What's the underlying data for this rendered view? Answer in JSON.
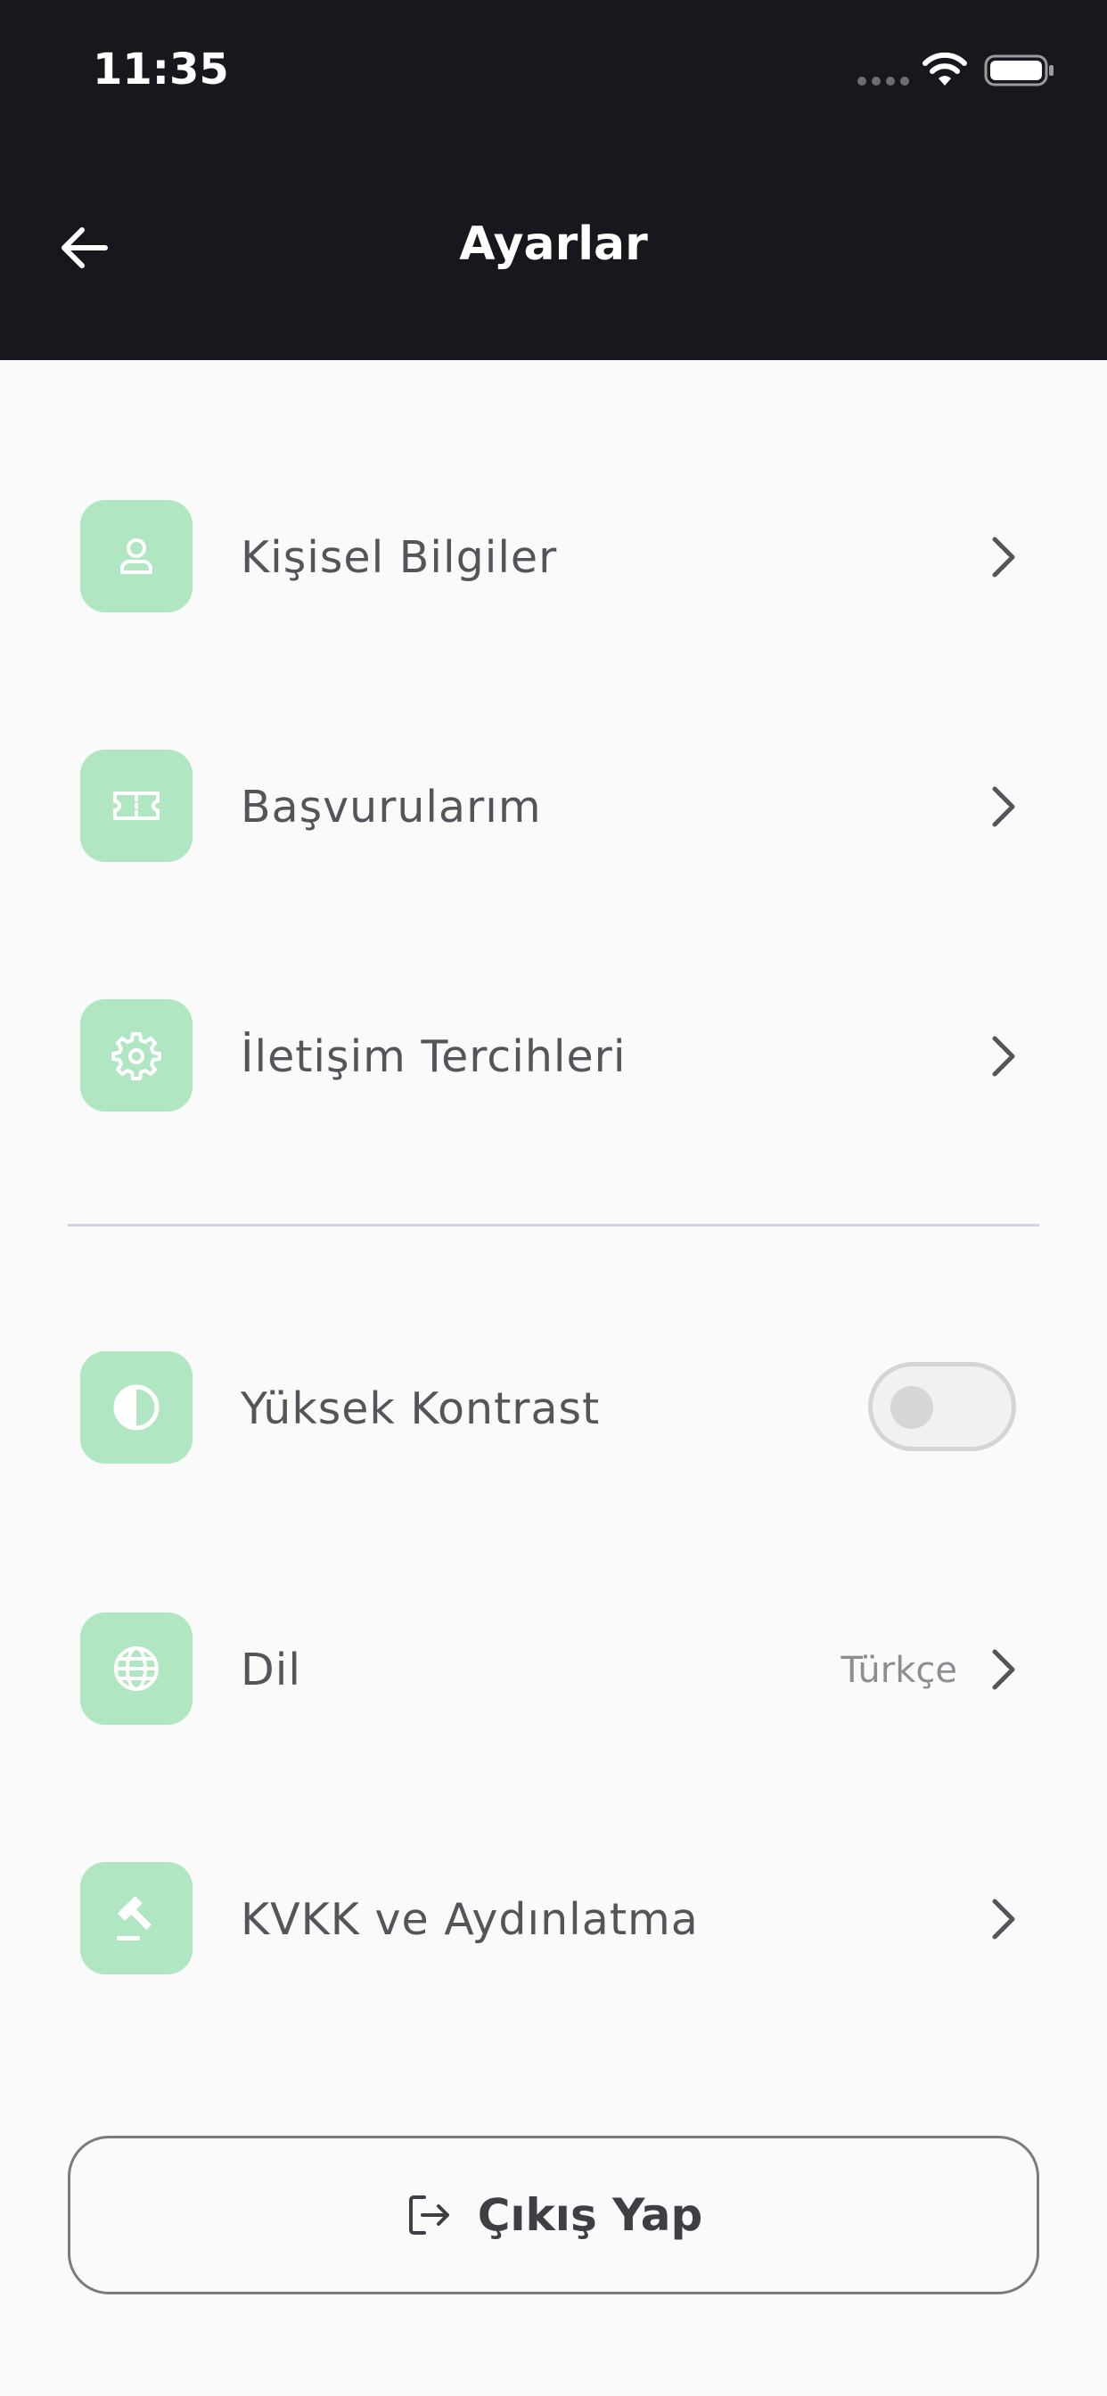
{
  "status_bar": {
    "time": "11:35"
  },
  "header": {
    "title": "Ayarlar"
  },
  "menu": [
    {
      "label": "Kişisel Bilgiler",
      "icon": "person-icon"
    },
    {
      "label": "Başvurularım",
      "icon": "ticket-icon"
    },
    {
      "label": "İletişim Tercihleri",
      "icon": "gear-icon"
    }
  ],
  "settings": {
    "high_contrast": {
      "label": "Yüksek Kontrast",
      "icon": "contrast-icon",
      "enabled": false
    },
    "language": {
      "label": "Dil",
      "value": "Türkçe",
      "icon": "globe-icon"
    },
    "kvkk": {
      "label": "KVKK ve Aydınlatma",
      "icon": "gavel-icon"
    }
  },
  "logout": {
    "label": "Çıkış Yap",
    "icon": "logout-icon"
  },
  "colors": {
    "header_bg": "#18171d",
    "icon_bg": "#b0e6c1",
    "page_bg": "#fafafa",
    "text": "#55545a"
  }
}
